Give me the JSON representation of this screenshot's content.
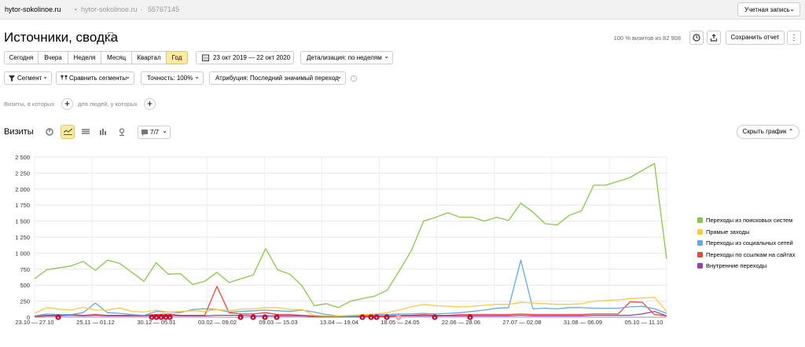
{
  "topbar": {
    "site": "hytor-sokolinoe.ru",
    "other_site": "hytor-sokolinoe.ru",
    "separator": "·",
    "counter_id": "55767145",
    "account_label": "Учетная запись"
  },
  "page": {
    "title": "Источники, сводка",
    "visits_pct": "100 % визитов из 82 908",
    "save_report": "Сохранить отчет"
  },
  "periods": [
    "Сегодня",
    "Вчера",
    "Неделя",
    "Месяц",
    "Квартал",
    "Год"
  ],
  "active_period": "Год",
  "date_range": "23 окт 2019 — 22 окт 2020",
  "detail": "Детализация: по неделям",
  "filters": {
    "segment": "Сегмент",
    "compare": "Сравнить сегменты",
    "accuracy": "Точность: 100%",
    "attribution": "Атрибуция: Последний значимый переход"
  },
  "segments_row": {
    "visits_where": "Визиты, в которых",
    "people_where": "для людей, у которых"
  },
  "chart_section": {
    "title": "Визиты",
    "annotations_count": "7/7",
    "hide_chart": "Скрыть график"
  },
  "colors": {
    "search": "#8ac554",
    "direct": "#f5cb48",
    "social": "#64a9e0",
    "links": "#e9493b",
    "internal": "#8e44ad",
    "accent_yellow": "#ffeba0",
    "marker_red": "#c0103a"
  },
  "chart_data": {
    "type": "line",
    "title": "",
    "xlabel": "",
    "ylabel": "",
    "ylim": [
      0,
      2500
    ],
    "yticks": [
      "0",
      "250",
      "500",
      "750",
      "1 000",
      "1 250",
      "1 500",
      "1 750",
      "2 000",
      "2 250",
      "2 500"
    ],
    "xtick_labels": [
      "23.10 — 27.10",
      "25.11 — 01.12",
      "30.12 — 05.01",
      "03.02 — 09.02",
      "09.03 — 15.03",
      "13.04 — 19.04",
      "18.05 — 24.05",
      "22.06 — 28.06",
      "27.07 — 02.08",
      "31.08 — 06.09",
      "05.10 — 11.10"
    ],
    "grid": true,
    "legend": "right",
    "series": [
      {
        "name": "Переходы из поисковых систем",
        "color_key": "search",
        "values": [
          600,
          740,
          770,
          800,
          870,
          730,
          890,
          840,
          700,
          560,
          850,
          670,
          680,
          510,
          560,
          700,
          540,
          600,
          660,
          1070,
          740,
          670,
          490,
          180,
          210,
          150,
          250,
          290,
          330,
          420,
          720,
          1040,
          1500,
          1560,
          1630,
          1560,
          1560,
          1500,
          1560,
          1510,
          1780,
          1640,
          1460,
          1440,
          1590,
          1660,
          2060,
          2060,
          2120,
          2180,
          2290,
          2400,
          910
        ]
      },
      {
        "name": "Прямые заходы",
        "color_key": "direct",
        "values": [
          60,
          150,
          125,
          110,
          155,
          110,
          110,
          145,
          90,
          80,
          110,
          80,
          90,
          100,
          90,
          120,
          100,
          125,
          130,
          150,
          150,
          120,
          120,
          30,
          20,
          20,
          30,
          40,
          50,
          70,
          110,
          160,
          200,
          180,
          170,
          160,
          170,
          185,
          200,
          200,
          230,
          220,
          210,
          200,
          200,
          210,
          250,
          260,
          270,
          290,
          300,
          310,
          90
        ]
      },
      {
        "name": "Переходы из социальных сетей",
        "color_key": "social",
        "values": [
          20,
          50,
          40,
          40,
          70,
          220,
          70,
          60,
          40,
          30,
          90,
          80,
          70,
          120,
          130,
          120,
          80,
          90,
          100,
          110,
          100,
          90,
          110,
          80,
          40,
          20,
          20,
          30,
          40,
          40,
          50,
          50,
          60,
          50,
          60,
          70,
          90,
          110,
          140,
          150,
          890,
          130,
          140,
          130,
          150,
          150,
          140,
          140,
          140,
          160,
          170,
          130,
          60
        ]
      },
      {
        "name": "Переходы по ссылкам на сайтах",
        "color_key": "links",
        "values": [
          20,
          30,
          30,
          40,
          30,
          40,
          30,
          30,
          30,
          30,
          40,
          50,
          30,
          30,
          30,
          480,
          70,
          50,
          50,
          70,
          40,
          40,
          30,
          20,
          10,
          10,
          10,
          20,
          20,
          20,
          30,
          30,
          40,
          30,
          30,
          40,
          40,
          40,
          40,
          40,
          50,
          40,
          40,
          40,
          40,
          40,
          50,
          50,
          50,
          240,
          230,
          40,
          20
        ]
      },
      {
        "name": "Внутренние переходы",
        "color_key": "internal",
        "values": [
          10,
          20,
          20,
          30,
          20,
          30,
          20,
          20,
          20,
          20,
          30,
          30,
          20,
          20,
          20,
          30,
          30,
          30,
          20,
          20,
          20,
          20,
          20,
          10,
          10,
          10,
          10,
          10,
          10,
          10,
          20,
          20,
          20,
          20,
          20,
          20,
          20,
          20,
          20,
          20,
          30,
          20,
          20,
          20,
          20,
          20,
          30,
          30,
          30,
          30,
          50,
          90,
          20
        ]
      }
    ]
  }
}
